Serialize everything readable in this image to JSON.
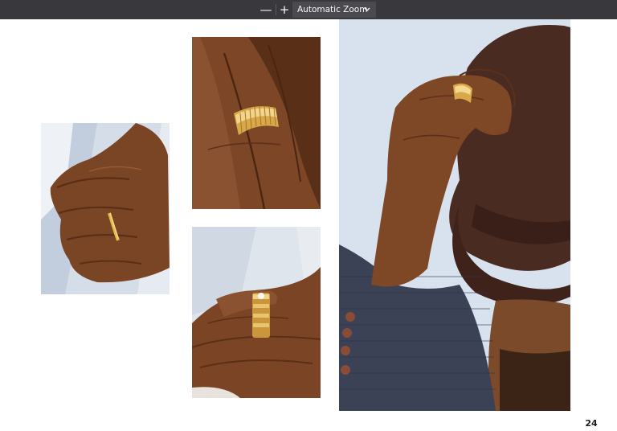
{
  "toolbar": {
    "zoom_out_label": "—",
    "zoom_in_label": "+",
    "zoom_value": "Automatic Zoom",
    "zoom_out_icon": "minus-icon",
    "zoom_in_icon": "plus-icon",
    "dropdown_icon": "chevron-down-icon"
  },
  "document": {
    "page_number": "24"
  }
}
